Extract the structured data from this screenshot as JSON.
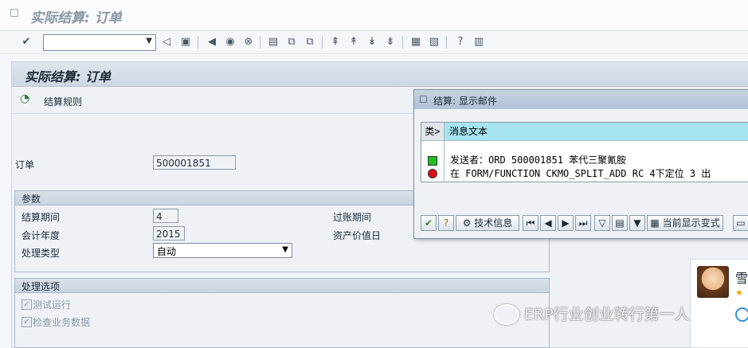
{
  "window": {
    "title": "实际结算: 订单"
  },
  "toolbar": {
    "command_field_value": ""
  },
  "screen": {
    "header": "实际结算: 订单",
    "rule_button": "结算规则",
    "order": {
      "label": "订单",
      "value": "500001851"
    },
    "params": {
      "title": "参数",
      "period_label": "结算期间",
      "period_value": "4",
      "fiscal_year_label": "会计年度",
      "fiscal_year_value": "2015",
      "processing_type_label": "处理类型",
      "processing_type_value": "自动",
      "posting_period_label": "过账期间",
      "asset_value_date_label": "资产价值日"
    },
    "options": {
      "title": "处理选项",
      "test_run": "测试运行",
      "check_business_data": "检查业务数据"
    }
  },
  "popup": {
    "title": "结算: 显示邮件",
    "col_type": "类>",
    "col_text": "消息文本",
    "messages": [
      {
        "status": "green",
        "text": "发送者：ORD 500001851 苯代三聚氰胺"
      },
      {
        "status": "red",
        "text": "在 FORM/FUNCTION CKMO_SPLIT_ADD RC 4下定位 3 出"
      }
    ],
    "buttons": {
      "tech_info": "技术信息",
      "current_variant": "当前显示变式"
    }
  },
  "chat": {
    "name": "雪"
  },
  "watermark": "ERP行业创业转行第一人",
  "colors": {
    "highlight": "#a6e4f0",
    "led_green": "#20c020",
    "led_red": "#e01010"
  }
}
